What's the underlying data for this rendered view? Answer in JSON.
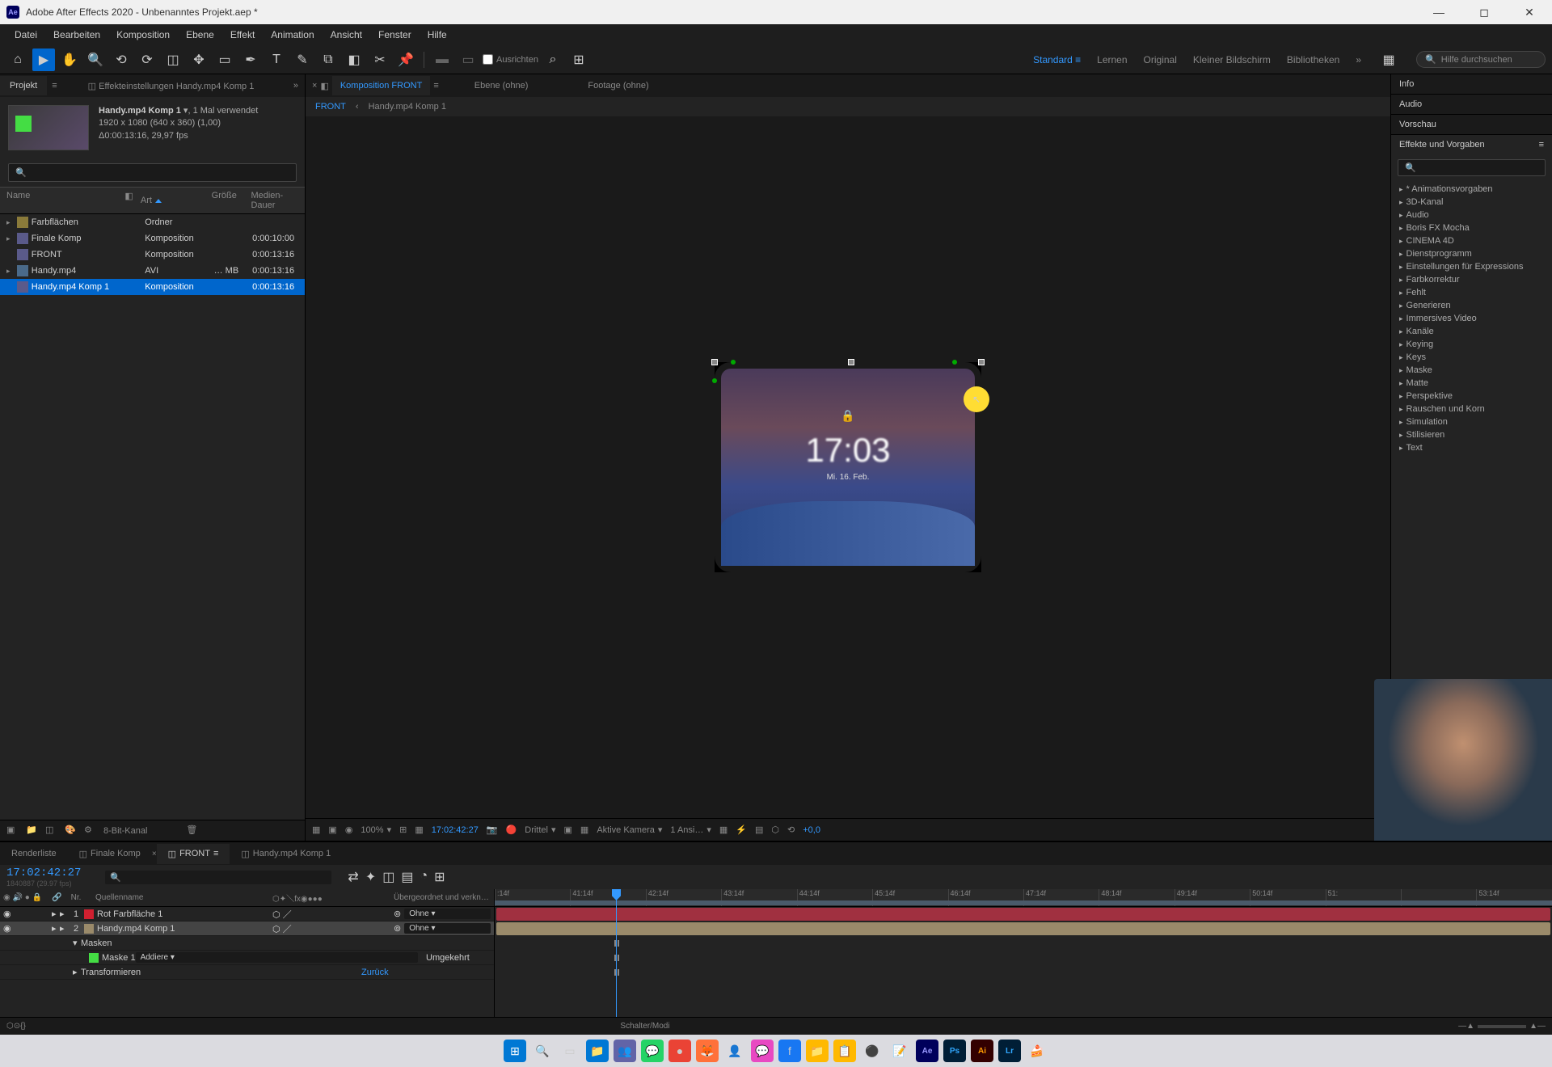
{
  "titlebar": {
    "app_icon": "Ae",
    "title": "Adobe After Effects 2020 - Unbenanntes Projekt.aep *"
  },
  "menu": [
    "Datei",
    "Bearbeiten",
    "Komposition",
    "Ebene",
    "Effekt",
    "Animation",
    "Ansicht",
    "Fenster",
    "Hilfe"
  ],
  "toolbar": {
    "align": "Ausrichten",
    "workspaces": [
      "Standard",
      "Lernen",
      "Original",
      "Kleiner Bildschirm",
      "Bibliotheken"
    ],
    "search_placeholder": "Hilfe durchsuchen"
  },
  "project_panel": {
    "tab_project": "Projekt",
    "tab_effect": "Effekteinstellungen Handy.mp4 Komp 1",
    "comp_name": "Handy.mp4 Komp 1",
    "used": ", 1 Mal verwendet",
    "resolution": "1920 x 1080 (640 x 360) (1,00)",
    "duration": "Δ0:00:13:16, 29,97 fps",
    "cols": {
      "name": "Name",
      "type": "Art",
      "size": "Größe",
      "dur": "Medien-Dauer"
    },
    "rows": [
      {
        "name": "Farbflächen",
        "type": "Ordner",
        "size": "",
        "dur": "",
        "icon": "folder",
        "arrow": "▸"
      },
      {
        "name": "Finale Komp",
        "type": "Komposition",
        "size": "",
        "dur": "0:00:10:00",
        "icon": "comp",
        "arrow": "▸"
      },
      {
        "name": "FRONT",
        "type": "Komposition",
        "size": "",
        "dur": "0:00:13:16",
        "icon": "comp",
        "arrow": ""
      },
      {
        "name": "Handy.mp4",
        "type": "AVI",
        "size": "… MB",
        "dur": "0:00:13:16",
        "icon": "video",
        "arrow": "▸"
      },
      {
        "name": "Handy.mp4 Komp 1",
        "type": "Komposition",
        "size": "",
        "dur": "0:00:13:16",
        "icon": "comp",
        "arrow": "",
        "selected": true
      }
    ],
    "footer_bpc": "8-Bit-Kanal"
  },
  "comp_panel": {
    "tab_comp": "Komposition FRONT",
    "tab_layer": "Ebene (ohne)",
    "tab_footage": "Footage (ohne)",
    "crumb1": "FRONT",
    "crumb2": "Handy.mp4 Komp 1",
    "phone_time": "17:03",
    "phone_date": "Mi. 16. Feb.",
    "zoom": "100%",
    "timecode": "17:02:42:27",
    "resolution": "Drittel",
    "camera": "Aktive Kamera",
    "views": "1 Ansi…",
    "exposure": "+0,0"
  },
  "right_panel": {
    "info": "Info",
    "audio": "Audio",
    "preview": "Vorschau",
    "effects": "Effekte und Vorgaben",
    "effects_list": [
      "* Animationsvorgaben",
      "3D-Kanal",
      "Audio",
      "Boris FX Mocha",
      "CINEMA 4D",
      "Dienstprogramm",
      "Einstellungen für Expressions",
      "Farbkorrektur",
      "Fehlt",
      "Generieren",
      "Immersives Video",
      "Kanäle",
      "Keying",
      "Keys",
      "Maske",
      "Matte",
      "Perspektive",
      "Rauschen und Korn",
      "Simulation",
      "Stilisieren",
      "Text"
    ]
  },
  "timeline": {
    "tab_render": "Renderliste",
    "tab_finale": "Finale Komp",
    "tab_front": "FRONT",
    "tab_handy": "Handy.mp4 Komp 1",
    "timecode": "17:02:42:27",
    "frames": "1840887 (29.97 fps)",
    "col_nr": "Nr.",
    "col_source": "Quellenname",
    "col_parent": "Übergeordnet und verkn…",
    "layers": [
      {
        "nr": "1",
        "color": "#d02030",
        "name": "Rot Farbfläche 1",
        "parent": "Ohne"
      },
      {
        "nr": "2",
        "color": "#9a8a6a",
        "name": "Handy.mp4 Komp 1",
        "parent": "Ohne",
        "selected": true
      }
    ],
    "sub_masks": "Masken",
    "sub_mask1": "Maske 1",
    "mask_mode": "Addiere",
    "mask_invert": "Umgekehrt",
    "sub_transform": "Transformieren",
    "transform_reset": "Zurück",
    "ticks": [
      ":14f",
      "41:14f",
      "42:14f",
      "43:14f",
      "44:14f",
      "45:14f",
      "46:14f",
      "47:14f",
      "48:14f",
      "49:14f",
      "50:14f",
      "51:",
      "",
      "53:14f"
    ],
    "footer": "Schalter/Modi"
  }
}
